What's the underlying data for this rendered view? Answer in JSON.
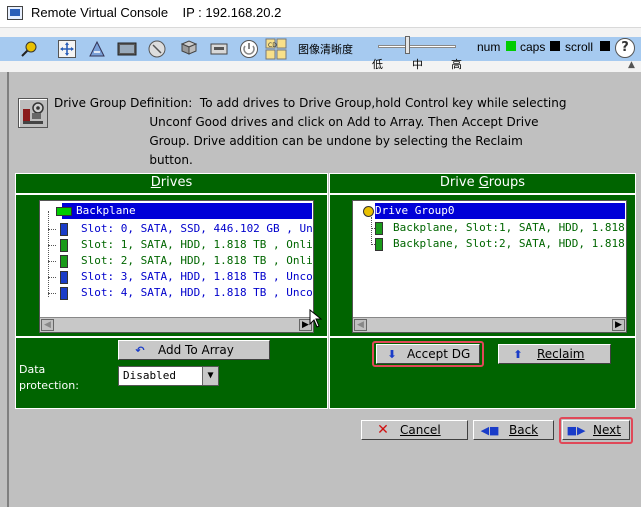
{
  "window": {
    "title": "Remote Virtual Console",
    "ip_label": "IP : 192.168.20.2"
  },
  "toolbar": {
    "icons": [
      "pin-icon",
      "move-icon",
      "macro-icon",
      "keyboard-icon",
      "mouse-icon",
      "drive-icon",
      "power-icon",
      "cd-icon",
      "media-icon"
    ],
    "cd_icon_text": "CD",
    "quality_label": "图像清晰度",
    "slider_ticks": {
      "low": "低",
      "mid": "中",
      "high": "高"
    },
    "indicators": {
      "num_label": "num",
      "num_color": "#00cc00",
      "caps_label": "caps",
      "caps_color": "#000000",
      "scroll_label": "scroll",
      "scroll_color": "#000000"
    },
    "help_label": "?"
  },
  "dialog": {
    "instruction": "Drive Group Definition:  To add drives to Drive Group,hold Control key while selecting\n                         Unconf Good drives and click on Add to Array. Then Accept Drive\n                         Group. Drive addition can be undone by selecting the Reclaim\n                         button.",
    "drives_panel": {
      "header_pre": "",
      "header_u": "D",
      "header_post": "rives",
      "root_label": "Backplane",
      "rows": [
        "Slot: 0, SATA, SSD, 446.102 GB , Unco",
        "Slot: 1, SATA, HDD, 1.818 TB , Online",
        "Slot: 2, SATA, HDD, 1.818 TB , Online",
        "Slot: 3, SATA, HDD, 1.818 TB , Unconf",
        "Slot: 4, SATA, HDD, 1.818 TB , Uncon"
      ],
      "row_colors": [
        "#0000cc",
        "#006600",
        "#006600",
        "#0000cc",
        "#0000cc"
      ],
      "add_button": "Add To Array",
      "dp_label": "Data\nprotection:",
      "dp_value": "Disabled"
    },
    "groups_panel": {
      "header_pre": "Drive ",
      "header_u": "G",
      "header_post": "roups",
      "root_label": "Drive Group0",
      "rows": [
        "Backplane, Slot:1, SATA, HDD, 1.818",
        "Backplane, Slot:2, SATA, HDD, 1.818"
      ],
      "accept_button": "Accept DG",
      "reclaim_button": "Reclaim"
    },
    "buttons": {
      "cancel": "Cancel",
      "back": "Back",
      "next": "Next"
    }
  },
  "colors": {
    "panel_green": "#006400",
    "selection_blue": "#0000d8",
    "toolbar_strip": "#a6caf0",
    "highlight_red": "#e04858"
  }
}
